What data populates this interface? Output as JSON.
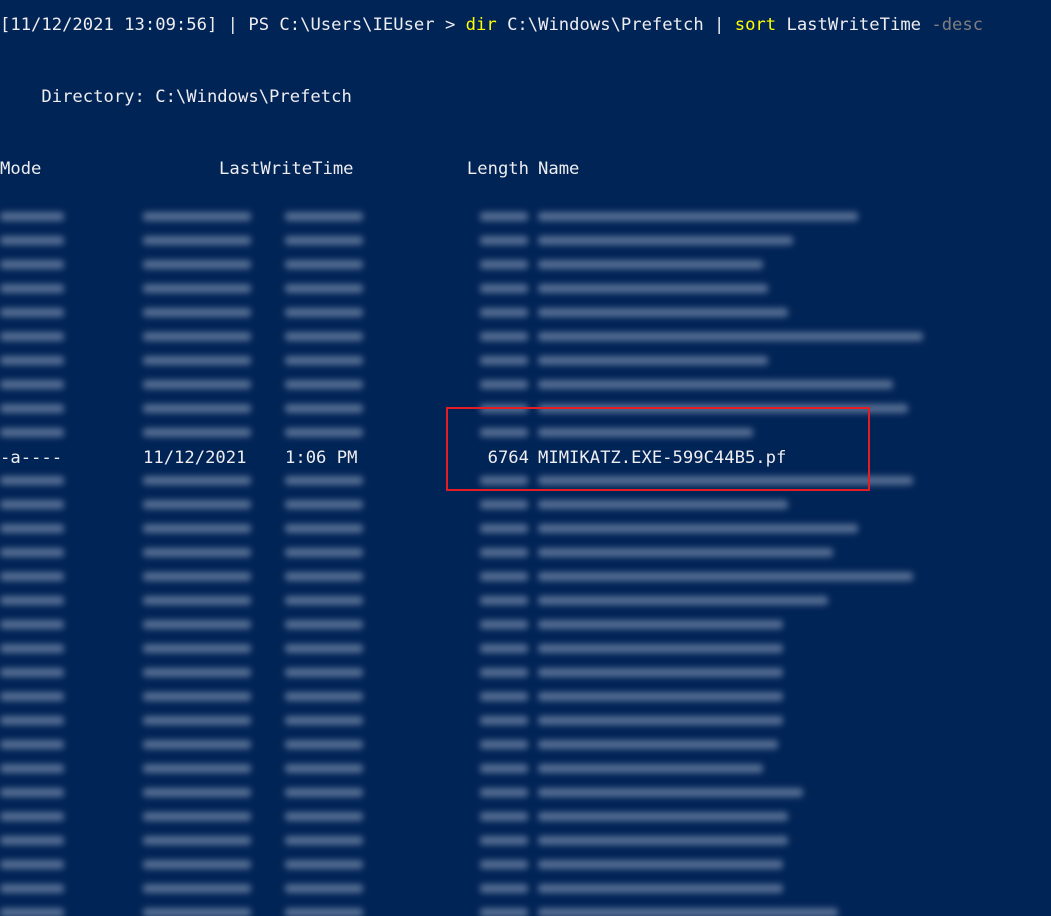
{
  "prompt": {
    "timestamp": "[11/12/2021 13:09:56]",
    "separator": " | ",
    "ps_path": "PS C:\\Users\\IEUser > ",
    "cmd_dir": "dir",
    "dir_arg": " C:\\Windows\\Prefetch ",
    "pipe": "|",
    "cmd_sort": " sort",
    "sort_arg": " LastWriteTime ",
    "sort_flag": "-desc"
  },
  "directory_line": "    Directory: C:\\Windows\\Prefetch",
  "headers": {
    "mode": "Mode",
    "last_write_time": "LastWriteTime",
    "length": "Length",
    "name": "Name"
  },
  "highlighted_row": {
    "mode": "-a----",
    "date": "11/12/2021",
    "time": "1:06 PM",
    "length": "6764",
    "name": "MIMIKATZ.EXE-599C44B5.pf"
  },
  "colors": {
    "background": "#012456",
    "text": "#eeedf0",
    "command": "#ffff00",
    "parameter": "#7f7f7f",
    "highlight_border": "#e41d24"
  }
}
